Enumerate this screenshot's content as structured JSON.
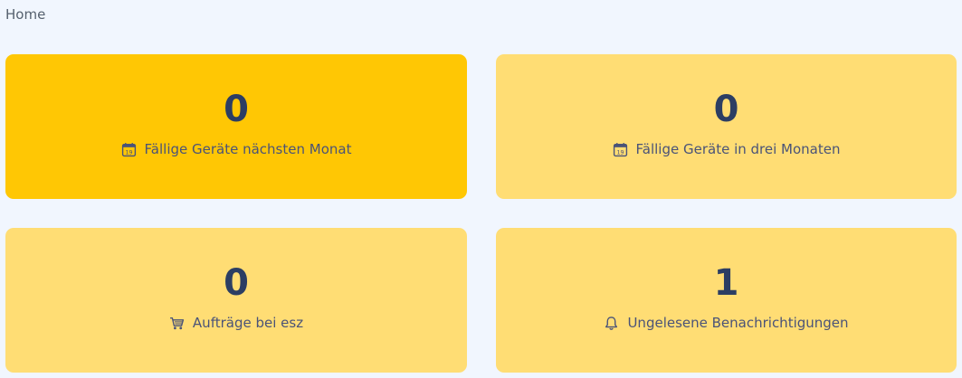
{
  "breadcrumb": {
    "label": "Home"
  },
  "cards": [
    {
      "count": "0",
      "label": "Fällige Geräte nächsten Monat",
      "icon": "calendar-icon",
      "color": "#ffc704"
    },
    {
      "count": "0",
      "label": "Fällige Geräte in drei Monaten",
      "icon": "calendar-icon",
      "color": "#ffdd74"
    },
    {
      "count": "0",
      "label": "Aufträge bei esz",
      "icon": "cart-icon",
      "color": "#ffdd74"
    },
    {
      "count": "1",
      "label": "Ungelesene Benachrichtigungen",
      "icon": "bell-icon",
      "color": "#ffdd74"
    }
  ],
  "calendar_icon_day": "19"
}
